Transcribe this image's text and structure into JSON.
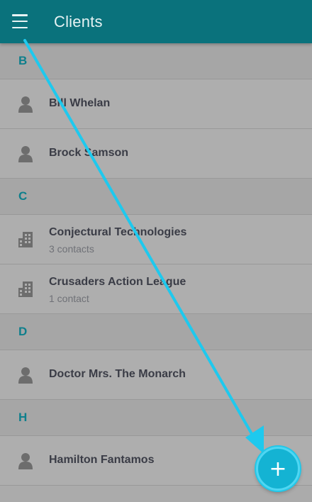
{
  "appbar": {
    "title": "Clients",
    "menu_icon": "hamburger-menu-icon",
    "color": "#0a727c"
  },
  "sections": [
    {
      "letter": "B",
      "items": [
        {
          "name": "Bill Whelan",
          "subtitle": "",
          "icon": "person-icon"
        },
        {
          "name": "Brock Samson",
          "subtitle": "",
          "icon": "person-icon"
        }
      ]
    },
    {
      "letter": "C",
      "items": [
        {
          "name": "Conjectural Technologies",
          "subtitle": "3 contacts",
          "icon": "building-icon"
        },
        {
          "name": "Crusaders Action League",
          "subtitle": "1 contact",
          "icon": "building-icon"
        }
      ]
    },
    {
      "letter": "D",
      "items": [
        {
          "name": "Doctor Mrs. The Monarch",
          "subtitle": "",
          "icon": "person-icon"
        }
      ]
    },
    {
      "letter": "H",
      "items": [
        {
          "name": "Hamilton Fantamos",
          "subtitle": "",
          "icon": "person-icon"
        }
      ]
    }
  ],
  "fab": {
    "label": "+",
    "icon": "plus-icon",
    "color": "#14b3d3"
  },
  "annotation": {
    "icon": "arrow-annotation-icon",
    "color": "#1ec9ee"
  }
}
